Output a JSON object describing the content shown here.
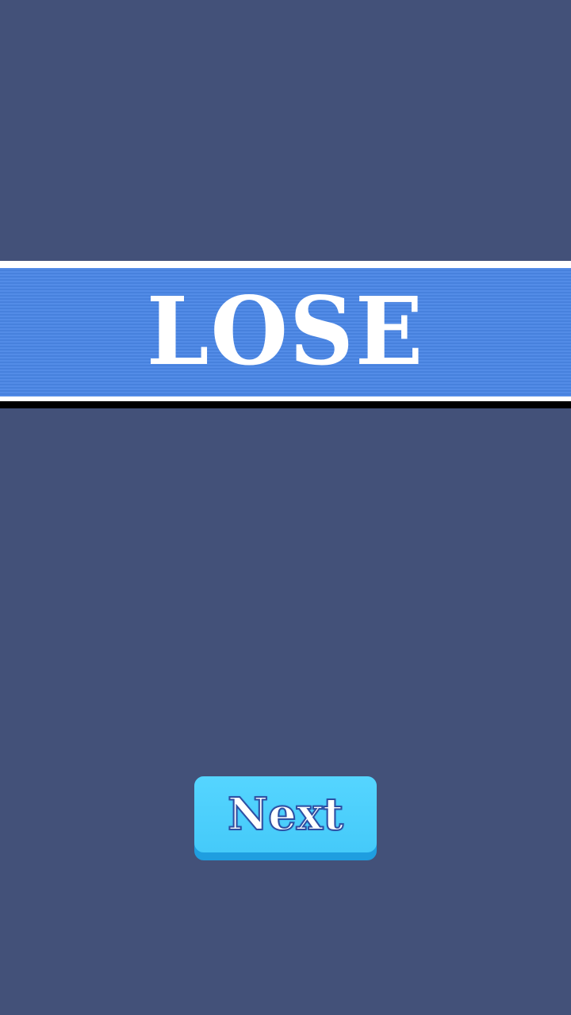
{
  "result": {
    "title": "LOSE"
  },
  "actions": {
    "next_label": "Next"
  },
  "colors": {
    "background": "#435179",
    "banner": "#4a86e6",
    "button": "#45caf9",
    "button_shadow": "#1f9ee0",
    "text": "#ffffff"
  }
}
